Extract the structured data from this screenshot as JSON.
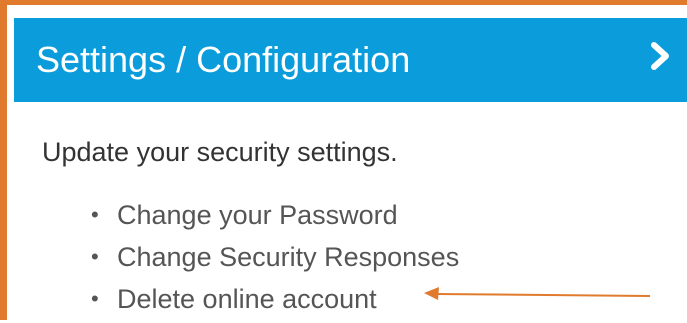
{
  "header": {
    "title": "Settings / Configuration",
    "expand_icon": "chevron-right-icon"
  },
  "intro_text": "Update your security settings.",
  "links": [
    {
      "label": "Change your Password"
    },
    {
      "label": "Change Security Responses"
    },
    {
      "label": "Delete online account"
    }
  ],
  "annotation": {
    "icon": "arrow-left-icon",
    "color": "#e07b2e"
  },
  "colors": {
    "header_bg": "#0b9ddb",
    "frame": "#e07b2e"
  }
}
